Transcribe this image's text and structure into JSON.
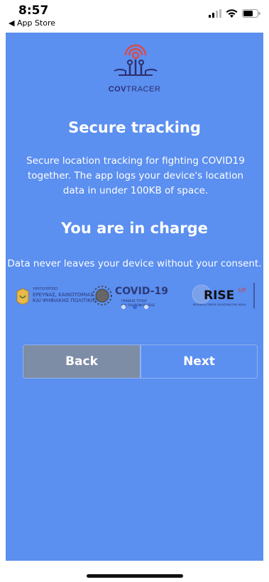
{
  "status_bar": {
    "time": "8:57",
    "back_label": "◀ App Store"
  },
  "brand": {
    "name_bold": "COV",
    "name_rest": "TRACER"
  },
  "section1": {
    "title": "Secure tracking",
    "description": "Secure location tracking for fighting COVID19 together. The app logs your device's location data in under 100KB of space."
  },
  "section2": {
    "title": "You are in charge",
    "description": "Data never leaves your device without your consent."
  },
  "partner_logos": {
    "ministry_line1": "ΥΦΥΠΟΥΡΓΕΙΟ",
    "ministry_line2": "ΕΡΕΥΝΑΣ, ΚΑΙΝΟΤΟΜΙΑΣ",
    "ministry_line3": "ΚΑΙ ΨΗΦΙΑΚΗΣ ΠΟΛΙΤΙΚΗΣ",
    "covid_title": "COVID-19",
    "covid_sub1": "ΓΡΑΦΕΙΟ ΤΥΠΟΥ",
    "covid_sub2": "ΚΑΙ ΠΛΗΡΟΦΟΡΗΣΗΣ",
    "rise_main": "RISE",
    "rise_sup": "UP",
    "rise_sub": "RESEARCH CENTRE ON INTERACTIVE MEDIA"
  },
  "pager": {
    "count": 3,
    "active_index": 1
  },
  "buttons": {
    "back": "Back",
    "next": "Next"
  },
  "colors": {
    "background": "#5b8ff0",
    "back_button": "#7e8da6",
    "active_dot": "#3a64d8"
  }
}
